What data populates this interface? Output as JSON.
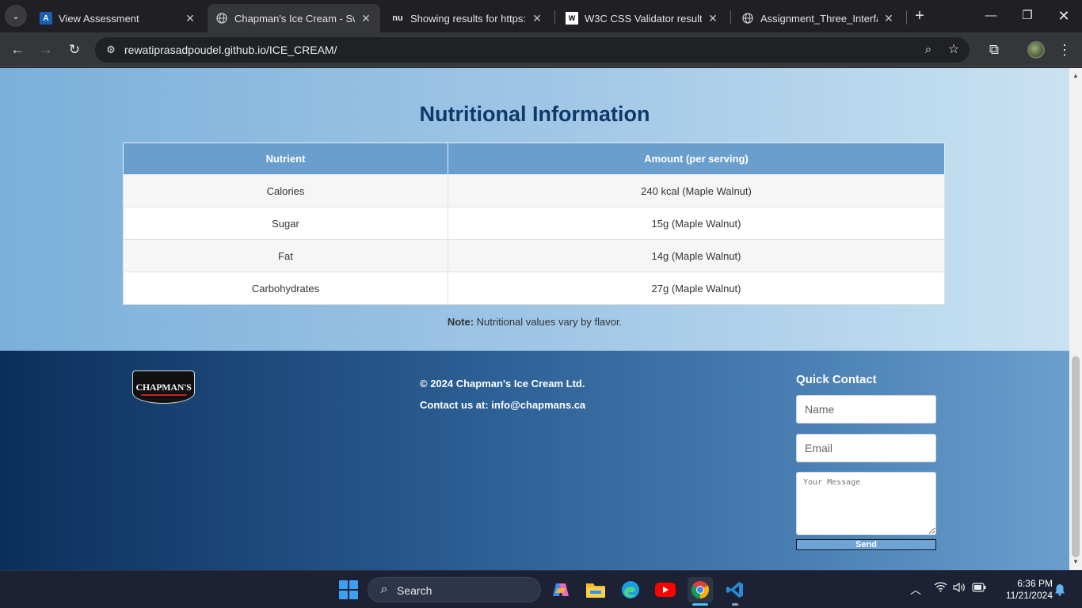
{
  "browser": {
    "tabs": [
      {
        "title": "View Assessment",
        "favicon": "A"
      },
      {
        "title": "Chapman's Ice Cream - Swee",
        "favicon": "globe"
      },
      {
        "title": "Showing results for https://r",
        "favicon": "nu"
      },
      {
        "title": "W3C CSS Validator results fo",
        "favicon": "w3c"
      },
      {
        "title": "Assignment_Three_Interface",
        "favicon": "globe"
      }
    ],
    "url": "rewatiprasadpoudel.github.io/ICE_CREAM/"
  },
  "nutrition": {
    "title": "Nutritional Information",
    "headers": [
      "Nutrient",
      "Amount (per serving)"
    ],
    "rows": [
      [
        "Calories",
        "240 kcal (Maple Walnut)"
      ],
      [
        "Sugar",
        "15g (Maple Walnut)"
      ],
      [
        "Fat",
        "14g (Maple Walnut)"
      ],
      [
        "Carbohydrates",
        "27g (Maple Walnut)"
      ]
    ],
    "note_label": "Note:",
    "note_text": " Nutritional values vary by flavor."
  },
  "footer": {
    "logo_text": "CHAPMAN'S",
    "copyright": "© 2024 Chapman's Ice Cream Ltd.",
    "contact": "Contact us at: info@chapmans.ca",
    "quick_contact": {
      "title": "Quick Contact",
      "name_placeholder": "Name",
      "email_placeholder": "Email",
      "message_placeholder": "Your Message",
      "send_label": "Send"
    }
  },
  "taskbar": {
    "search_label": "Search",
    "time": "6:36 PM",
    "date": "11/21/2024"
  }
}
